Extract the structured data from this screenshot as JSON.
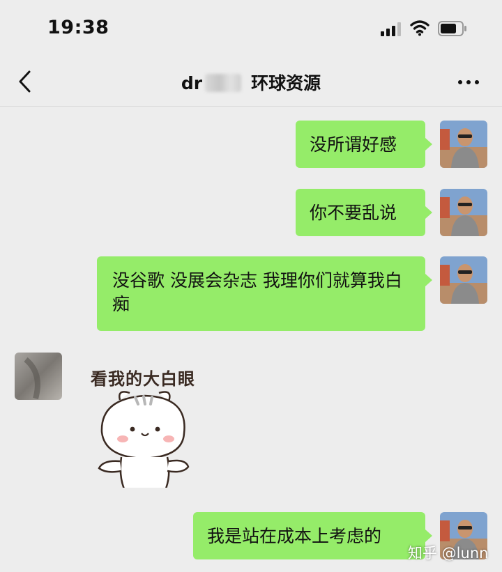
{
  "status_bar": {
    "time": "19:38"
  },
  "header": {
    "title_prefix": "dr",
    "title_suffix": "环球资源"
  },
  "messages": [
    {
      "side": "right",
      "text": "没所谓好感"
    },
    {
      "side": "right",
      "text": "你不要乱说"
    },
    {
      "side": "right",
      "text": "没谷歌 没展会杂志  我理你们就算我白痴"
    },
    {
      "side": "left",
      "type": "sticker",
      "caption": "看我的大白眼"
    },
    {
      "side": "right",
      "text": "我是站在成本上考虑的"
    }
  ],
  "watermark": "知乎 @lunn",
  "colors": {
    "background": "#ededed",
    "bubble_green": "#95ec69"
  }
}
